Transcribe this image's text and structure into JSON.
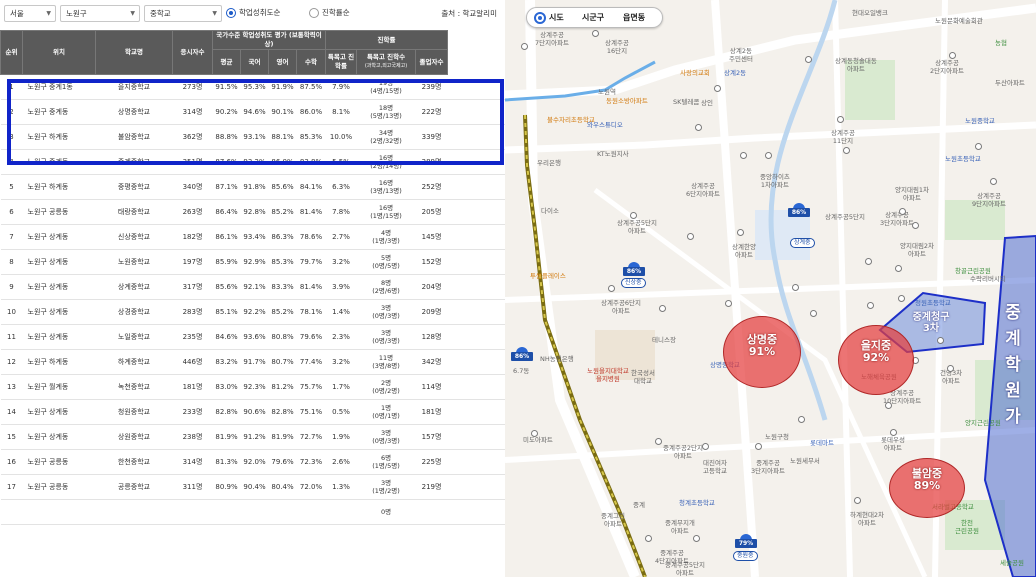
{
  "filters": {
    "city": "서울",
    "district": "노원구",
    "level": "중학교",
    "radio_achievement": "학업성취도순",
    "radio_advance": "진학률순",
    "source": "출처 : 학교알리미"
  },
  "table": {
    "headers": {
      "rank": "순위",
      "location": "위치",
      "school": "학교명",
      "applicants": "응시자수",
      "national_group": "국가수준 학업성취도 평가 (보통학력이상)",
      "advance_group": "진학률",
      "avg": "평균",
      "korean": "국어",
      "english": "영어",
      "math": "수학",
      "special_rate": "특목고 진학률",
      "special_count": "특목고 진학수",
      "special_count_sub": "(과학고,외고국제고)",
      "graduates": "졸업자수"
    },
    "rows": [
      {
        "rank": "1",
        "loc": "노원구 중계1동",
        "school": "을지중학교",
        "n": "273명",
        "avg": "91.5%",
        "kor": "95.3%",
        "eng": "91.9%",
        "math": "87.5%",
        "sr": "7.9%",
        "sc1": "19명",
        "sc2": "(4명/15명)",
        "grad": "239명"
      },
      {
        "rank": "2",
        "loc": "노원구 중계동",
        "school": "상명중학교",
        "n": "314명",
        "avg": "90.2%",
        "kor": "94.6%",
        "eng": "90.1%",
        "math": "86.0%",
        "sr": "8.1%",
        "sc1": "18명",
        "sc2": "(5명/13명)",
        "grad": "222명"
      },
      {
        "rank": "3",
        "loc": "노원구 하계동",
        "school": "불암중학교",
        "n": "362명",
        "avg": "88.8%",
        "kor": "93.1%",
        "eng": "88.1%",
        "math": "85.3%",
        "sr": "10.0%",
        "sc1": "34명",
        "sc2": "(2명/32명)",
        "grad": "339명"
      },
      {
        "rank": "4",
        "loc": "노원구 중계동",
        "school": "중계중학교",
        "n": "351명",
        "avg": "87.6%",
        "kor": "93.2%",
        "eng": "86.0%",
        "math": "83.8%",
        "sr": "5.5%",
        "sc1": "16명",
        "sc2": "(2명/14명)",
        "grad": "289명"
      },
      {
        "rank": "5",
        "loc": "노원구 하계동",
        "school": "중평중학교",
        "n": "340명",
        "avg": "87.1%",
        "kor": "91.8%",
        "eng": "85.6%",
        "math": "84.1%",
        "sr": "6.3%",
        "sc1": "16명",
        "sc2": "(3명/13명)",
        "grad": "252명"
      },
      {
        "rank": "6",
        "loc": "노원구 공릉동",
        "school": "태랑중학교",
        "n": "263명",
        "avg": "86.4%",
        "kor": "92.8%",
        "eng": "85.2%",
        "math": "81.4%",
        "sr": "7.8%",
        "sc1": "16명",
        "sc2": "(1명/15명)",
        "grad": "205명"
      },
      {
        "rank": "7",
        "loc": "노원구 상계동",
        "school": "신상중학교",
        "n": "182명",
        "avg": "86.1%",
        "kor": "93.4%",
        "eng": "86.3%",
        "math": "78.6%",
        "sr": "2.7%",
        "sc1": "4명",
        "sc2": "(1명/3명)",
        "grad": "145명"
      },
      {
        "rank": "8",
        "loc": "노원구 상계동",
        "school": "노원중학교",
        "n": "197명",
        "avg": "85.9%",
        "kor": "92.9%",
        "eng": "85.3%",
        "math": "79.7%",
        "sr": "3.2%",
        "sc1": "5명",
        "sc2": "(0명/5명)",
        "grad": "152명"
      },
      {
        "rank": "9",
        "loc": "노원구 상계동",
        "school": "상계중학교",
        "n": "317명",
        "avg": "85.6%",
        "kor": "92.1%",
        "eng": "83.3%",
        "math": "81.4%",
        "sr": "3.9%",
        "sc1": "8명",
        "sc2": "(2명/6명)",
        "grad": "204명"
      },
      {
        "rank": "10",
        "loc": "노원구 상계동",
        "school": "상경중학교",
        "n": "283명",
        "avg": "85.1%",
        "kor": "92.2%",
        "eng": "85.2%",
        "math": "78.1%",
        "sr": "1.4%",
        "sc1": "3명",
        "sc2": "(0명/3명)",
        "grad": "209명"
      },
      {
        "rank": "11",
        "loc": "노원구 상계동",
        "school": "노일중학교",
        "n": "235명",
        "avg": "84.6%",
        "kor": "93.6%",
        "eng": "80.8%",
        "math": "79.6%",
        "sr": "2.3%",
        "sc1": "3명",
        "sc2": "(0명/3명)",
        "grad": "128명"
      },
      {
        "rank": "12",
        "loc": "노원구 하계동",
        "school": "하계중학교",
        "n": "446명",
        "avg": "83.2%",
        "kor": "91.7%",
        "eng": "80.7%",
        "math": "77.4%",
        "sr": "3.2%",
        "sc1": "11명",
        "sc2": "(3명/8명)",
        "grad": "342명"
      },
      {
        "rank": "13",
        "loc": "노원구 월계동",
        "school": "녹천중학교",
        "n": "181명",
        "avg": "83.0%",
        "kor": "92.3%",
        "eng": "81.2%",
        "math": "75.7%",
        "sr": "1.7%",
        "sc1": "2명",
        "sc2": "(0명/2명)",
        "grad": "114명"
      },
      {
        "rank": "14",
        "loc": "노원구 상계동",
        "school": "청원중학교",
        "n": "233명",
        "avg": "82.8%",
        "kor": "90.6%",
        "eng": "82.8%",
        "math": "75.1%",
        "sr": "0.5%",
        "sc1": "1명",
        "sc2": "(0명/1명)",
        "grad": "181명"
      },
      {
        "rank": "15",
        "loc": "노원구 상계동",
        "school": "상원중학교",
        "n": "238명",
        "avg": "81.9%",
        "kor": "91.2%",
        "eng": "81.9%",
        "math": "72.7%",
        "sr": "1.9%",
        "sc1": "3명",
        "sc2": "(0명/3명)",
        "grad": "157명"
      },
      {
        "rank": "16",
        "loc": "노원구 공릉동",
        "school": "한천중학교",
        "n": "314명",
        "avg": "81.3%",
        "kor": "92.0%",
        "eng": "79.6%",
        "math": "72.3%",
        "sr": "2.6%",
        "sc1": "6명",
        "sc2": "(1명/5명)",
        "grad": "225명"
      },
      {
        "rank": "17",
        "loc": "노원구 공릉동",
        "school": "공릉중학교",
        "n": "311명",
        "avg": "80.9%",
        "kor": "90.4%",
        "eng": "80.4%",
        "math": "72.0%",
        "sr": "1.3%",
        "sc1": "3명",
        "sc2": "(1명/2명)",
        "grad": "219명"
      },
      {
        "rank": "",
        "loc": "",
        "school": "",
        "n": "",
        "avg": "",
        "kor": "",
        "eng": "",
        "math": "",
        "sr": "",
        "sc1": "0명",
        "sc2": "",
        "grad": ""
      }
    ]
  },
  "map": {
    "controls": {
      "sido": "시도",
      "sigungu": "시군구",
      "eupmyeondong": "읍면동"
    },
    "school_circles": [
      {
        "name": "상명중",
        "pct": "91%"
      },
      {
        "name": "을지중",
        "pct": "92%"
      },
      {
        "name": "불암중",
        "pct": "89%"
      }
    ],
    "zone_label": "중계청구\n3차",
    "hakwon_label": "중계학원가",
    "pins": [
      {
        "pct": "86%",
        "tag": "상계중"
      },
      {
        "pct": "86%",
        "tag": "신상중"
      },
      {
        "pct": "86%",
        "tag": ""
      },
      {
        "pct": "79%",
        "tag": "중원중"
      }
    ],
    "labels": {
      "l1": "상계주공\n7단지아파트",
      "l2": "상계동성\n센트럴파크",
      "l3": "상계2동\n주민센터",
      "l4": "상계동청솔대동\n아파트",
      "l5": "현대오일뱅크",
      "l6": "상계주공\n16단지",
      "l7": "노원역",
      "l8": "SK텔레콤",
      "l9": "상인",
      "l10": "상계2동",
      "l11": "사랑의교회",
      "l12": "동원소방아파트",
      "l13": "불수자리초등학교",
      "l14": "와우스튜디오",
      "l15": "KT노원지사",
      "l16": "우리은행",
      "l17": "다이소",
      "l18": "상계주공5단지\n아파트",
      "l19": "상계주공\n6단지아파트",
      "l20": "중앙하이츠\n1차아파트",
      "l21": "상계한양\n아파트",
      "l22": "양지대림1차\n아파트",
      "l23": "투썸플레이스",
      "l24": "상계주공6단지\n아파트",
      "l25": "NH농협은행",
      "l26": "한국성서\n대학교",
      "l27": "노원을지대학교\n을지병원",
      "l28": "테니스장",
      "l29": "상명중학교",
      "l30": "노원구청",
      "l31": "노원세무서",
      "l32": "상계주공\n10단지아파트",
      "l33": "중계주공2단지\n아파트",
      "l34": "대진여자\n고등학교",
      "l35": "중계주공\n3단지아파트",
      "l36": "미도아파트",
      "l37": "청계초등학교",
      "l38": "중계그린\n아파트",
      "l39": "중계",
      "l40": "하계현대2차\n아파트",
      "l41": "롯데우성\n아파트",
      "l42": "서라벌고등학교",
      "l43": "세솔공원",
      "l44": "중계주공\n4단지아파트",
      "l45": "중계주공5단지\n아파트",
      "l46": "양지대림2차\n아파트",
      "l47": "상계주공\n3단지아파트",
      "l48": "청원초등학교",
      "l49": "수락리버시티",
      "l50": "상계주공\n9단지아파트",
      "l51": "건영3차\n아파트",
      "l52": "창골근린공원",
      "l53": "노원초등학교",
      "l54": "노해체육공원",
      "l55": "양지근린공원",
      "l56": "상계주공5단지",
      "l57": "노원중학교",
      "l58": "농협",
      "l59": "상계주공\n2단지아파트",
      "l60": "노원문화예술회관",
      "l61": "상계주공\n11단지",
      "l62": "두산아파트",
      "l63": "중계무지개\n아파트",
      "l64": "한천\n근린공원",
      "l65": "6.7동",
      "l66": "롯데마트"
    }
  }
}
